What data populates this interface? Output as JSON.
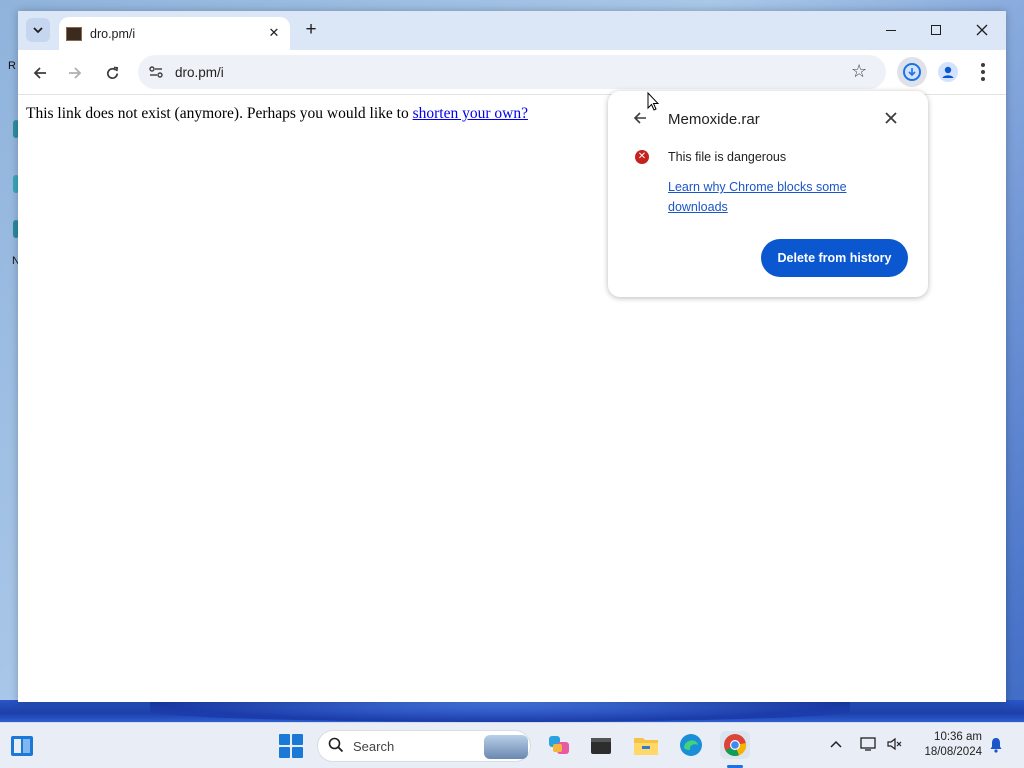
{
  "desktop": {
    "fragments": [
      "R",
      "N"
    ]
  },
  "browser": {
    "tab": {
      "title": "dro.pm/i",
      "close_glyph": "✕"
    },
    "new_tab_glyph": "+",
    "toolbar": {
      "url": "dro.pm/i"
    }
  },
  "page": {
    "text_before": "This link does not exist (anymore). Perhaps you would like to ",
    "link_text": "shorten your own?"
  },
  "download_bubble": {
    "filename": "Memoxide.rar",
    "status": "This file is dangerous",
    "learn_link": "Learn why Chrome blocks some downloads",
    "delete_button": "Delete from history",
    "danger_color": "#c5221f",
    "button_color": "#0b57d0"
  },
  "taskbar": {
    "search_placeholder": "Search",
    "time": "10:36 am",
    "date": "18/08/2024",
    "apps": [
      "copilot-icon",
      "terminal-icon",
      "file-explorer-icon",
      "edge-icon",
      "chrome-icon"
    ]
  }
}
